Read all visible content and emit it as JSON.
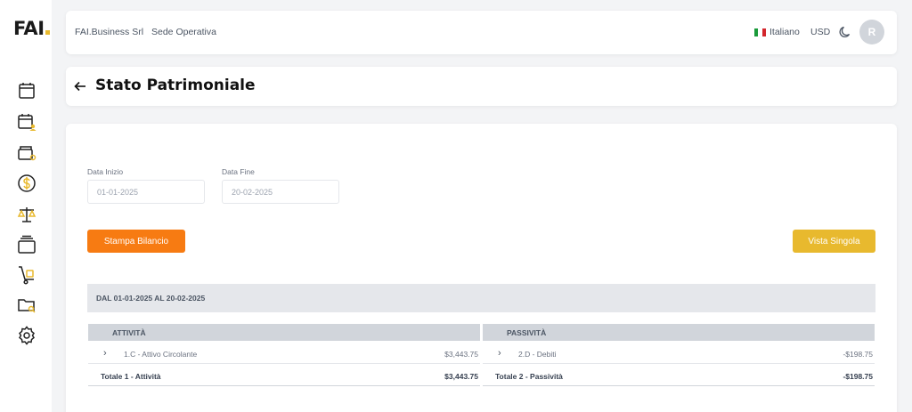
{
  "sidebar": {
    "logo": "FAI",
    "items": [
      {
        "icon": "calendar-icon"
      },
      {
        "icon": "calendar-user-icon"
      },
      {
        "icon": "wallet-settings-icon"
      },
      {
        "icon": "dollar-circle-icon"
      },
      {
        "icon": "balance-scale-icon"
      },
      {
        "icon": "layers-icon"
      },
      {
        "icon": "hand-truck-icon"
      },
      {
        "icon": "folder-search-icon"
      },
      {
        "icon": "settings-gear-icon"
      }
    ]
  },
  "header": {
    "company": "FAI.Business Srl",
    "branch": "Sede Operativa",
    "language": "Italiano",
    "currency": "USD",
    "avatar_initial": "R"
  },
  "page": {
    "title": "Stato Patrimoniale"
  },
  "filters": {
    "start_label": "Data Inizio",
    "start_value": "01-01-2025",
    "end_label": "Data Fine",
    "end_value": "20-02-2025"
  },
  "actions": {
    "print_label": "Stampa Bilancio",
    "view_label": "Vista Singola"
  },
  "report": {
    "range": "DAL 01-01-2025 AL 20-02-2025",
    "assets": {
      "header": "ATTIVITÀ",
      "rows": [
        {
          "label": "1.C - Attivo Circolante",
          "amount": "$3,443.75"
        }
      ],
      "total_label": "Totale 1 - Attività",
      "total_amount": "$3,443.75"
    },
    "liabilities": {
      "header": "PASSIVITÀ",
      "rows": [
        {
          "label": "2.D - Debiti",
          "amount": "-$198.75"
        }
      ],
      "total_label": "Totale 2 - Passività",
      "total_amount": "-$198.75"
    }
  },
  "colors": {
    "accent_orange": "#f77b12",
    "accent_yellow": "#e8b92e"
  }
}
